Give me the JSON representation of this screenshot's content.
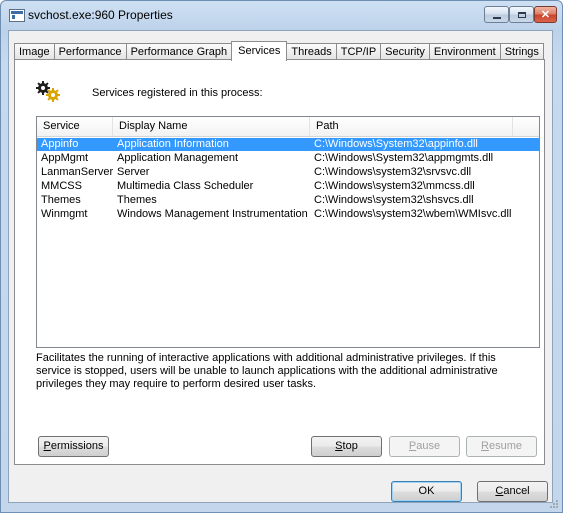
{
  "window": {
    "title": "svchost.exe:960 Properties"
  },
  "tabs": [
    {
      "label": "Image"
    },
    {
      "label": "Performance"
    },
    {
      "label": "Performance Graph"
    },
    {
      "label": "Services"
    },
    {
      "label": "Threads"
    },
    {
      "label": "TCP/IP"
    },
    {
      "label": "Security"
    },
    {
      "label": "Environment"
    },
    {
      "label": "Strings"
    }
  ],
  "active_tab": "Services",
  "services": {
    "heading": "Services registered in this process:",
    "columns": [
      "Service",
      "Display Name",
      "Path"
    ],
    "rows": [
      {
        "service": "Appinfo",
        "display_name": "Application Information",
        "path": "C:\\Windows\\System32\\appinfo.dll"
      },
      {
        "service": "AppMgmt",
        "display_name": "Application Management",
        "path": "C:\\Windows\\System32\\appmgmts.dll"
      },
      {
        "service": "LanmanServer",
        "display_name": "Server",
        "path": "C:\\Windows\\system32\\srvsvc.dll"
      },
      {
        "service": "MMCSS",
        "display_name": "Multimedia Class Scheduler",
        "path": "C:\\Windows\\system32\\mmcss.dll"
      },
      {
        "service": "Themes",
        "display_name": "Themes",
        "path": "C:\\Windows\\system32\\shsvcs.dll"
      },
      {
        "service": "Winmgmt",
        "display_name": "Windows Management Instrumentation",
        "path": "C:\\Windows\\system32\\wbem\\WMIsvc.dll"
      }
    ],
    "selected_row": 0,
    "description": "Facilitates the running of interactive applications with additional administrative privileges.  If this service is stopped, users will be unable to launch applications with the additional administrative privileges they may require to perform desired user tasks."
  },
  "buttons": {
    "permissions": {
      "label": "Permissions",
      "accel": "P",
      "rest": "ermissions"
    },
    "stop": {
      "label": "Stop",
      "accel": "S",
      "rest": "top"
    },
    "pause": {
      "label": "Pause",
      "accel": "P",
      "rest": "ause"
    },
    "resume": {
      "label": "Resume",
      "accel": "R",
      "rest": "esume"
    },
    "ok": {
      "label": "OK"
    },
    "cancel": {
      "label": "Cancel",
      "accel": "C",
      "rest": "ancel"
    }
  }
}
